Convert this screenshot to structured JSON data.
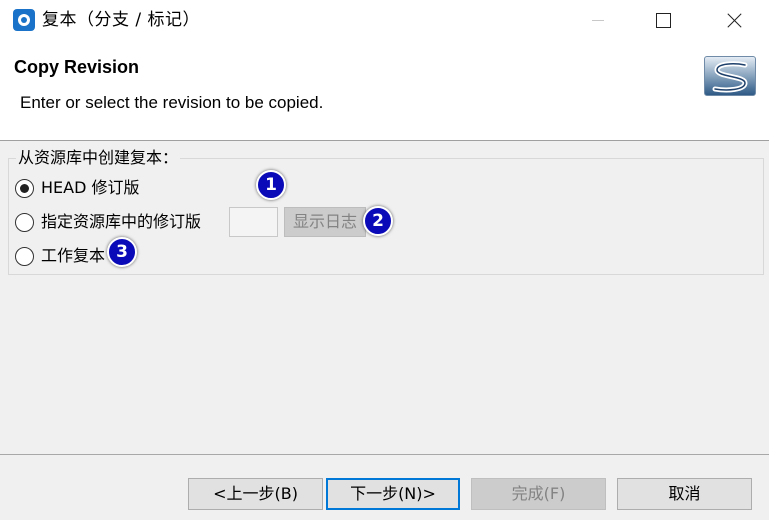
{
  "window": {
    "title": "复本（分支 / 标记）"
  },
  "header": {
    "title": "Copy Revision",
    "description": "Enter or select the revision to be copied.",
    "logo_icon": "subversion-s-logo-icon"
  },
  "copy_from": {
    "legend": "从资源库中创建复本：",
    "options": [
      {
        "label": "HEAD 修订版",
        "checked": true
      },
      {
        "label": "指定资源库中的修订版",
        "checked": false
      },
      {
        "label": "工作复本",
        "checked": false
      }
    ],
    "revision_value": "",
    "show_log_label": "显示日志"
  },
  "annotations": {
    "badges": [
      "1",
      "2",
      "3"
    ],
    "badge_color": "#0a0ab8"
  },
  "footer": {
    "back_label": "<上一步(B)",
    "next_label": "下一步(N)>",
    "finish_label": "完成(F)",
    "cancel_label": "取消"
  },
  "colors": {
    "accent": "#0078d7"
  }
}
